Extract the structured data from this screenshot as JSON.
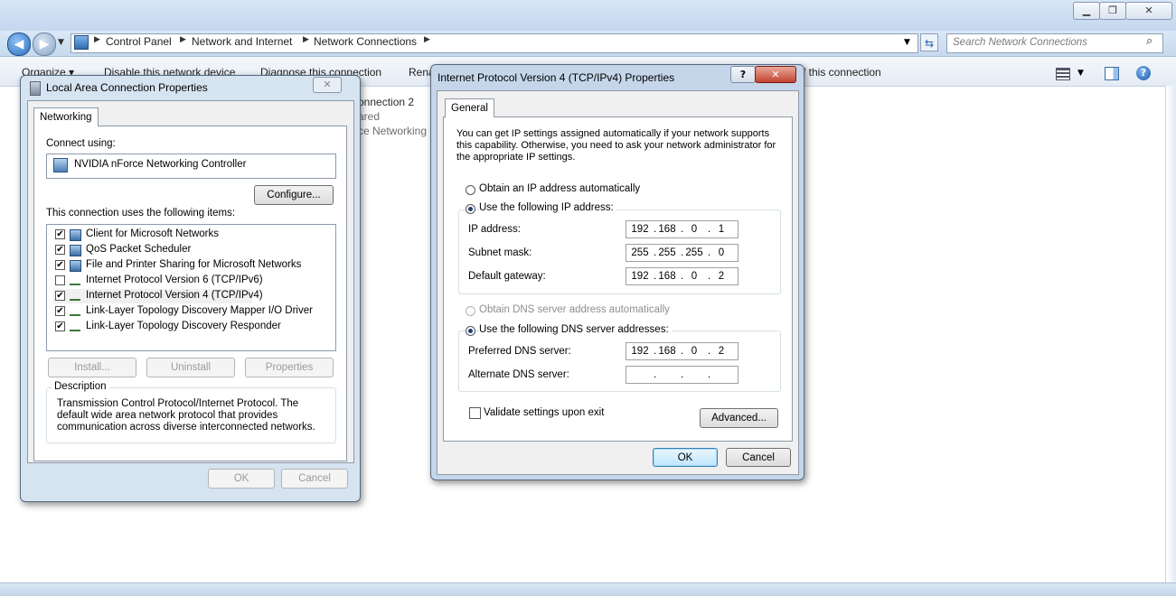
{
  "explorer": {
    "breadcrumb": [
      "Control Panel",
      "Network and Internet",
      "Network Connections"
    ],
    "search_placeholder": "Search Network Connections",
    "toolbar": {
      "organize": "Organize ▾",
      "disable": "Disable this network device",
      "diagnose": "Diagnose this connection",
      "rename": "Rena",
      "change_settings": "f this connection"
    },
    "background_connection": {
      "name": "onnection 2",
      "status": "ared",
      "adapter": "ce Networking"
    }
  },
  "lan_dialog": {
    "title": "Local Area Connection Properties",
    "tab": "Networking",
    "connect_using_label": "Connect using:",
    "adapter": "NVIDIA nForce Networking Controller",
    "configure": "Configure...",
    "items_label": "This connection uses the following items:",
    "items": [
      {
        "label": "Client for Microsoft Networks",
        "checked": true,
        "icon": "network-client-icon"
      },
      {
        "label": "QoS Packet Scheduler",
        "checked": true,
        "icon": "network-service-icon"
      },
      {
        "label": "File and Printer Sharing for Microsoft Networks",
        "checked": true,
        "icon": "network-service-icon"
      },
      {
        "label": "Internet Protocol Version 6 (TCP/IPv6)",
        "checked": false,
        "icon": "protocol-icon"
      },
      {
        "label": "Internet Protocol Version 4 (TCP/IPv4)",
        "checked": true,
        "icon": "protocol-icon"
      },
      {
        "label": "Link-Layer Topology Discovery Mapper I/O Driver",
        "checked": true,
        "icon": "protocol-icon"
      },
      {
        "label": "Link-Layer Topology Discovery Responder",
        "checked": true,
        "icon": "protocol-icon"
      }
    ],
    "install": "Install...",
    "uninstall": "Uninstall",
    "properties": "Properties",
    "description_label": "Description",
    "description": "Transmission Control Protocol/Internet Protocol. The default wide area network protocol that provides communication across diverse interconnected networks.",
    "ok": "OK",
    "cancel": "Cancel"
  },
  "ipv4_dialog": {
    "title": "Internet Protocol Version 4 (TCP/IPv4) Properties",
    "help": "?",
    "tab": "General",
    "intro": "You can get IP settings assigned automatically if your network supports this capability. Otherwise, you need to ask your network administrator for the appropriate IP settings.",
    "obtain_ip_auto": "Obtain an IP address automatically",
    "use_following_ip": "Use the following IP address:",
    "ip_label": "IP address:",
    "ip": [
      "192",
      "168",
      "0",
      "1"
    ],
    "subnet_label": "Subnet mask:",
    "subnet": [
      "255",
      "255",
      "255",
      "0"
    ],
    "gateway_label": "Default gateway:",
    "gateway": [
      "192",
      "168",
      "0",
      "2"
    ],
    "obtain_dns_auto": "Obtain DNS server address automatically",
    "use_following_dns": "Use the following DNS server addresses:",
    "preferred_dns_label": "Preferred DNS server:",
    "preferred_dns": [
      "192",
      "168",
      "0",
      "2"
    ],
    "alternate_dns_label": "Alternate DNS server:",
    "alternate_dns": [
      "",
      "",
      "",
      ""
    ],
    "validate": "Validate settings upon exit",
    "advanced": "Advanced...",
    "ok": "OK",
    "cancel": "Cancel"
  }
}
